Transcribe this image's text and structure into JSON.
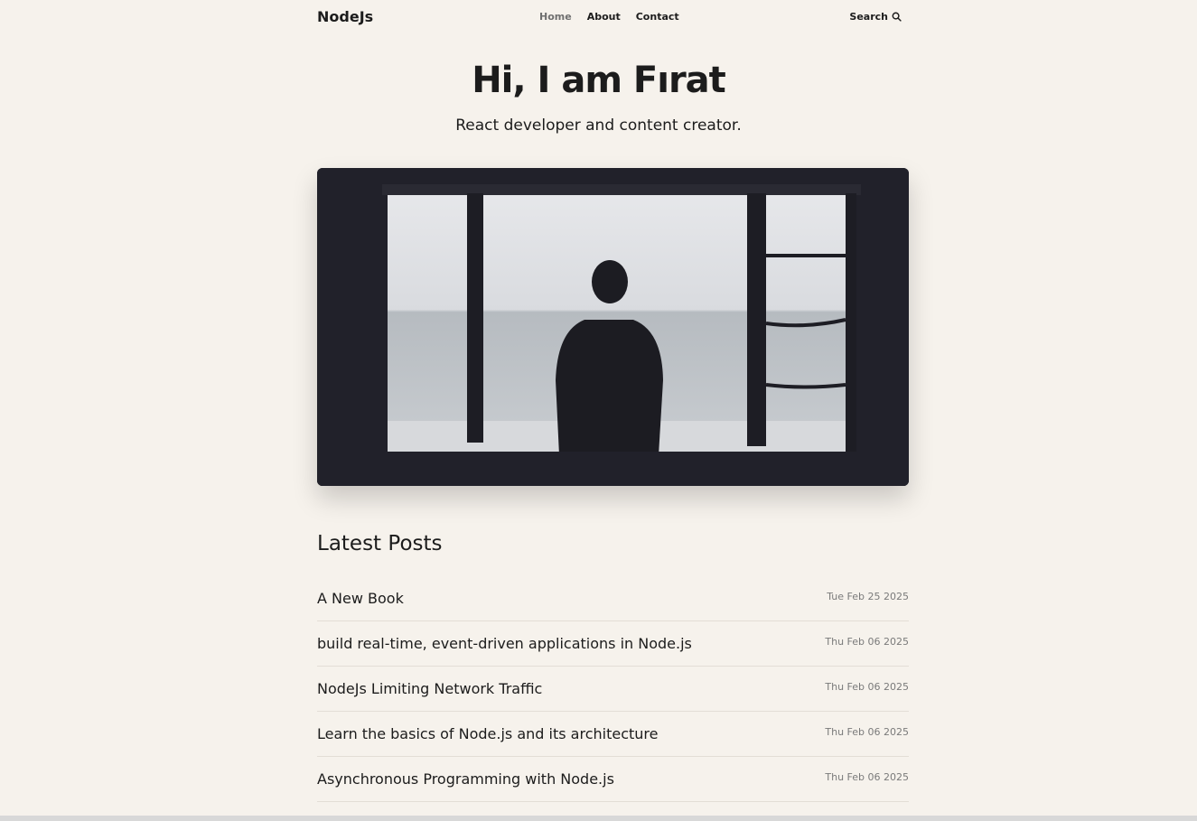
{
  "nav": {
    "logo": "NodeJs",
    "links": [
      {
        "label": "Home",
        "active": true
      },
      {
        "label": "About",
        "active": false
      },
      {
        "label": "Contact",
        "active": false
      }
    ],
    "search_label": "Search"
  },
  "hero": {
    "title": "Hi, I am Fırat",
    "subtitle": "React developer and content creator."
  },
  "posts": {
    "heading": "Latest Posts",
    "items": [
      {
        "title": "A New Book",
        "date": "Tue Feb 25 2025"
      },
      {
        "title": "build real-time, event-driven applications in Node.js",
        "date": "Thu Feb 06 2025"
      },
      {
        "title": "NodeJs Limiting Network Traffic",
        "date": "Thu Feb 06 2025"
      },
      {
        "title": "Learn the basics of Node.js and its architecture",
        "date": "Thu Feb 06 2025"
      },
      {
        "title": "Asynchronous Programming with Node.js",
        "date": "Thu Feb 06 2025"
      }
    ]
  },
  "colors": {
    "background": "#f6f2ec",
    "text": "#1c1c1c",
    "muted": "#7a7a7a"
  }
}
